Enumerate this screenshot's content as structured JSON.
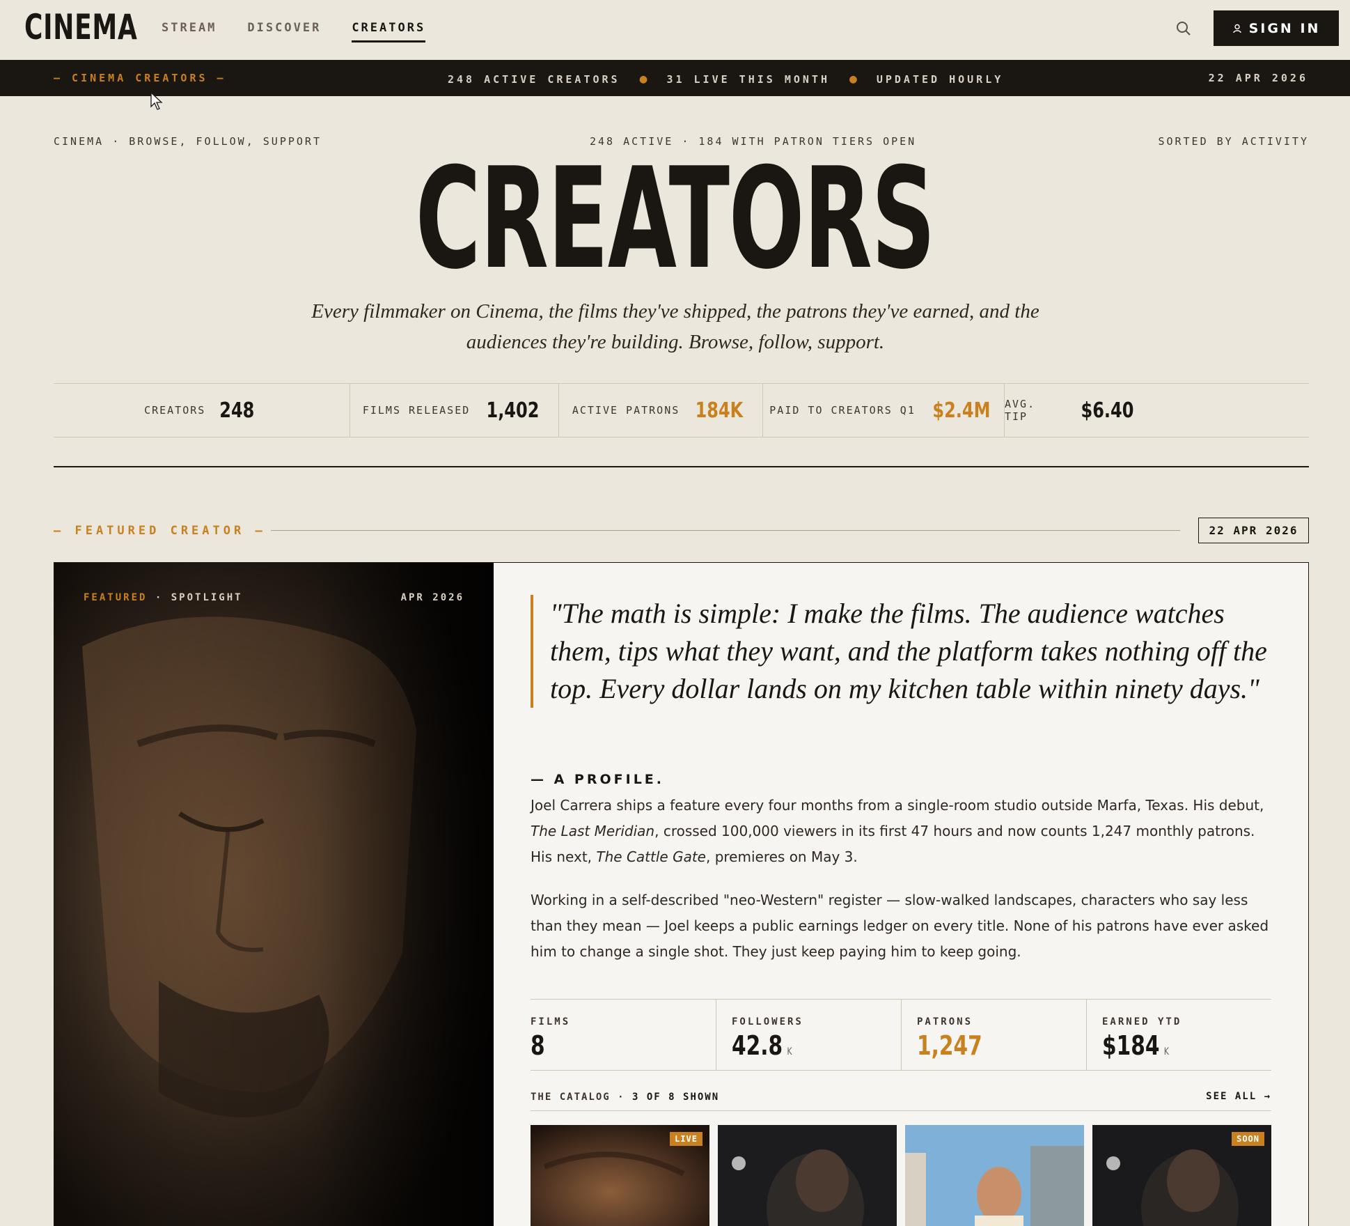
{
  "nav": {
    "logo": "CINEMA",
    "links": [
      "STREAM",
      "DISCOVER",
      "CREATORS"
    ],
    "active": "CREATORS",
    "sign_in": "SIGN IN"
  },
  "ticker": {
    "left": "— CINEMA CREATORS —",
    "items": [
      "248 ACTIVE CREATORS",
      "31 LIVE THIS MONTH",
      "UPDATED HOURLY"
    ],
    "date": "22 APR 2026"
  },
  "hero": {
    "meta_left": "CINEMA · BROWSE, FOLLOW, SUPPORT",
    "meta_center": "248 ACTIVE · 184 WITH PATRON TIERS OPEN",
    "meta_right": "SORTED BY ACTIVITY",
    "title": "CREATORS",
    "subtitle": "Every filmmaker on Cinema, the films they've shipped, the patrons they've earned, and the audiences they're building. Browse, follow, support."
  },
  "stats": [
    {
      "label": "CREATORS",
      "value": "248",
      "accent": false
    },
    {
      "label": "FILMS RELEASED",
      "value": "1,402",
      "accent": false
    },
    {
      "label": "ACTIVE PATRONS",
      "value": "184K",
      "accent": true
    },
    {
      "label": "PAID TO CREATORS Q1",
      "value": "$2.4M",
      "accent": true
    },
    {
      "label": "AVG. TIP",
      "value": "$6.40",
      "accent": false
    }
  ],
  "featured": {
    "label": "— FEATURED CREATOR —",
    "date": "22 APR 2026",
    "tag_featured": "FEATURED",
    "tag_spotlight": " · SPOTLIGHT",
    "tag_month": "APR 2026",
    "quote": "\"The math is simple: I make the films. The audience watches them, tips what they want, and the platform takes nothing off the top. Every dollar lands on my kitchen table within ninety days.\"",
    "profile_heading": "— A PROFILE.",
    "p1_a": "Joel Carrera ships a feature every four months from a single-room studio outside Marfa, Texas. His debut, ",
    "p1_title1": "The Last Meridian",
    "p1_b": ", crossed 100,000 viewers in its first 47 hours and now counts 1,247 monthly patrons. His next, ",
    "p1_title2": "The Cattle Gate",
    "p1_c": ", premieres on May 3.",
    "p2": "Working in a self-described \"neo-Western\" register — slow-walked landscapes, characters who say less than they mean — Joel keeps a public earnings ledger on every title. None of his patrons have ever asked him to change a single shot. They just keep paying him to keep going.",
    "kpis": [
      {
        "label": "FILMS",
        "value": "8",
        "unit": "",
        "accent": false
      },
      {
        "label": "FOLLOWERS",
        "value": "42.8",
        "unit": "K",
        "accent": false
      },
      {
        "label": "PATRONS",
        "value": "1,247",
        "unit": "",
        "accent": true
      },
      {
        "label": "EARNED YTD",
        "value": "$184",
        "unit": "K",
        "accent": false
      }
    ],
    "catalog_label": "THE CATALOG · ",
    "catalog_count": "3 OF 8 SHOWN",
    "see_all": "SEE ALL →",
    "thumbs": [
      {
        "badge": "LIVE"
      },
      {
        "badge": ""
      },
      {
        "badge": ""
      },
      {
        "badge": "SOON"
      }
    ]
  },
  "colors": {
    "accent": "#c9801e",
    "ink": "#1a1612",
    "paper": "#ece7dd"
  }
}
